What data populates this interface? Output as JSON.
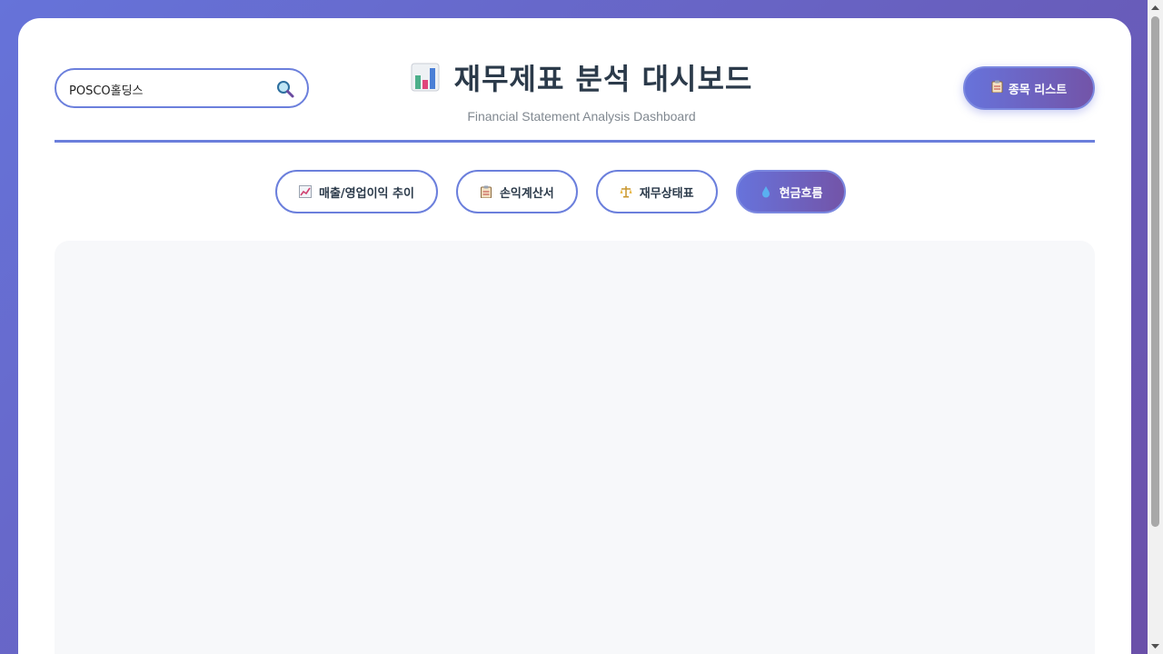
{
  "app": {
    "title": "재무제표 분석 대시보드",
    "subtitle": "Financial Statement Analysis Dashboard",
    "title_icon": "bar-chart-icon"
  },
  "search": {
    "value": "POSCO홀딩스",
    "icon": "search-icon"
  },
  "stock_list_button": {
    "label": "종목 리스트",
    "icon": "clipboard-icon"
  },
  "tabs": [
    {
      "label": "매출/영업이익 추이",
      "icon": "trend-chart-icon",
      "active": false
    },
    {
      "label": "손익계산서",
      "icon": "clipboard-icon",
      "active": false
    },
    {
      "label": "재무상태표",
      "icon": "balance-scale-icon",
      "active": false
    },
    {
      "label": "현금흐름",
      "icon": "droplet-icon",
      "active": true
    }
  ],
  "colors": {
    "accent": "#6b7fdc",
    "gradient_start": "#6773db",
    "gradient_end": "#7354a8",
    "title_text": "#2b3a4a",
    "content_bg": "#f7f8fa"
  }
}
